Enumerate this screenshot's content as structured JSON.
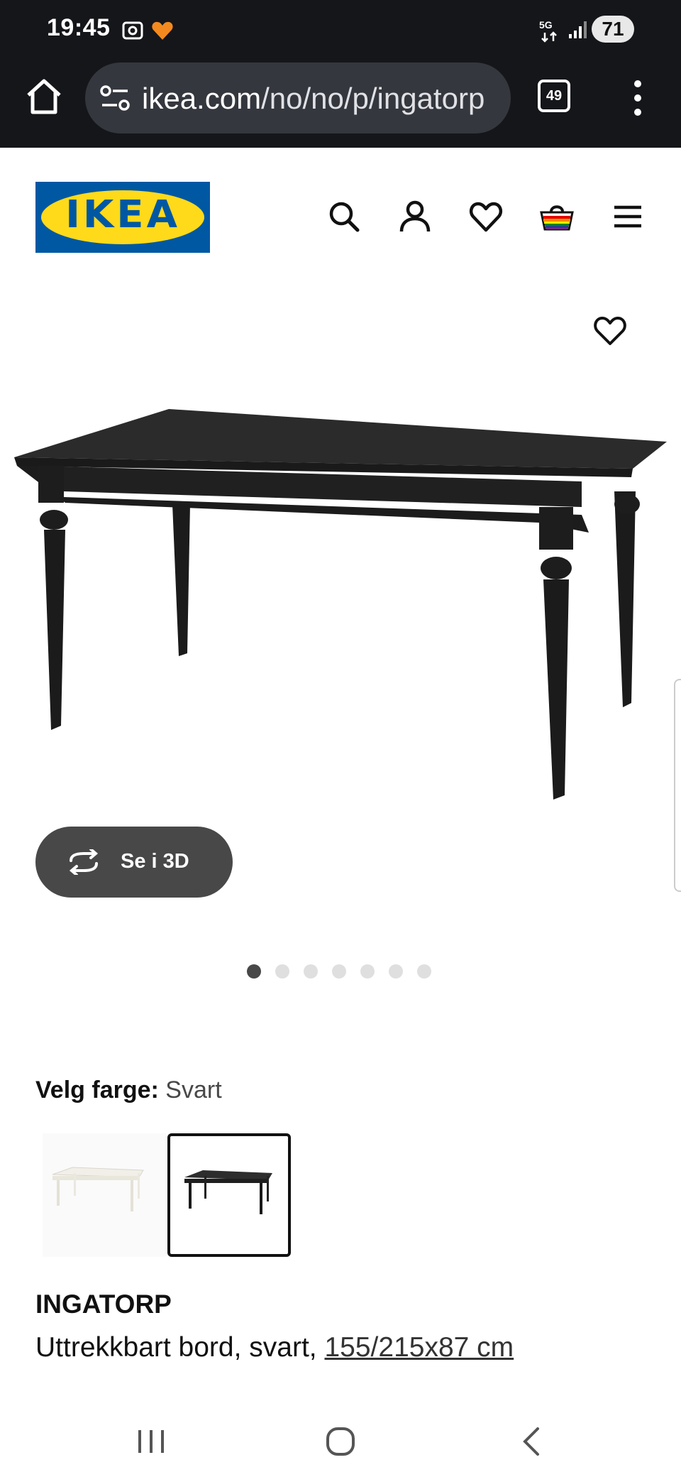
{
  "status_bar": {
    "time": "19:45",
    "network": "5G",
    "battery": "71"
  },
  "browser": {
    "url_domain": "ikea.com",
    "url_path": "/no/no/p/ingatorp",
    "tab_count": "49"
  },
  "header": {
    "logo_text": "IKEA"
  },
  "hero": {
    "view3d_label": "Se i 3D",
    "image_count": 7,
    "active_image": 1
  },
  "color": {
    "label": "Velg farge:",
    "value": "Svart",
    "options": [
      "white",
      "black"
    ],
    "selected": "black"
  },
  "product": {
    "name": "INGATORP",
    "description": "Uttrekkbart bord, svart, ",
    "size": "155/215x87 cm"
  },
  "colors": {
    "chrome": "#15161a",
    "ikea_blue": "#0058a3",
    "ikea_yellow": "#ffda1a",
    "button_dark": "#484848"
  }
}
